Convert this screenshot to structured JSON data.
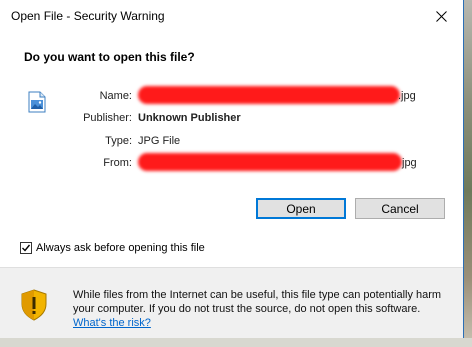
{
  "window": {
    "title": "Open File - Security Warning",
    "close_glyph": "✕"
  },
  "heading": "Do you want to open this file?",
  "file_info": {
    "name_label": "Name:",
    "name_value_suffix": ".jpg",
    "publisher_label": "Publisher:",
    "publisher_value": "Unknown Publisher",
    "type_label": "Type:",
    "type_value": "JPG File",
    "from_label": "From:",
    "from_value_suffix": "jpg"
  },
  "buttons": {
    "open_label": "Open",
    "cancel_label": "Cancel"
  },
  "checkbox": {
    "label": "Always ask before opening this file",
    "checked": true
  },
  "warning": {
    "text": "While files from the Internet can be useful, this file type can potentially harm your computer. If you do not trust the source, do not open this software.",
    "link_label": "What's the risk?"
  },
  "colors": {
    "accent": "#0078d7",
    "redaction": "#ff1a1a",
    "link": "#0066cc",
    "shield_yellow": "#f2b400"
  }
}
